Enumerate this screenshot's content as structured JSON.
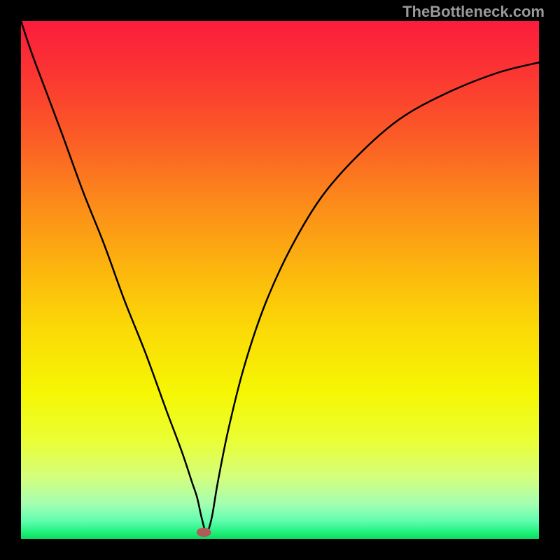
{
  "attribution": "TheBottleneck.com",
  "chart_data": {
    "type": "line",
    "title": "",
    "xlabel": "",
    "ylabel": "",
    "xlim": [
      0,
      100
    ],
    "ylim": [
      0,
      100
    ],
    "series": [
      {
        "name": "curve",
        "x": [
          0,
          2,
          5,
          8,
          12,
          16,
          20,
          24,
          28,
          31,
          33,
          34,
          34.9,
          35.8,
          36.8,
          38,
          40,
          43,
          47,
          52,
          58,
          65,
          73,
          82,
          92,
          100
        ],
        "y": [
          100,
          94,
          86,
          78,
          67,
          57,
          46,
          36,
          25,
          17,
          11,
          8,
          4,
          1.3,
          4,
          11,
          21,
          33,
          45,
          56,
          66,
          74,
          81,
          86,
          90,
          92
        ]
      }
    ],
    "marker": {
      "x": 35.3,
      "y": 1.3,
      "rx": 1.4,
      "ry": 0.9,
      "color": "#b15a59"
    },
    "gradient": {
      "stops": [
        {
          "offset": 0.0,
          "color": "#fb1c3c"
        },
        {
          "offset": 0.1,
          "color": "#fb3532"
        },
        {
          "offset": 0.22,
          "color": "#fb5a27"
        },
        {
          "offset": 0.35,
          "color": "#fc8a1a"
        },
        {
          "offset": 0.48,
          "color": "#fcb60e"
        },
        {
          "offset": 0.6,
          "color": "#fbdb06"
        },
        {
          "offset": 0.72,
          "color": "#f5f704"
        },
        {
          "offset": 0.81,
          "color": "#eafe35"
        },
        {
          "offset": 0.88,
          "color": "#d4fe7c"
        },
        {
          "offset": 0.93,
          "color": "#a7feb0"
        },
        {
          "offset": 0.965,
          "color": "#61fdaf"
        },
        {
          "offset": 0.985,
          "color": "#24f37f"
        },
        {
          "offset": 1.0,
          "color": "#0ddb5f"
        }
      ]
    }
  }
}
